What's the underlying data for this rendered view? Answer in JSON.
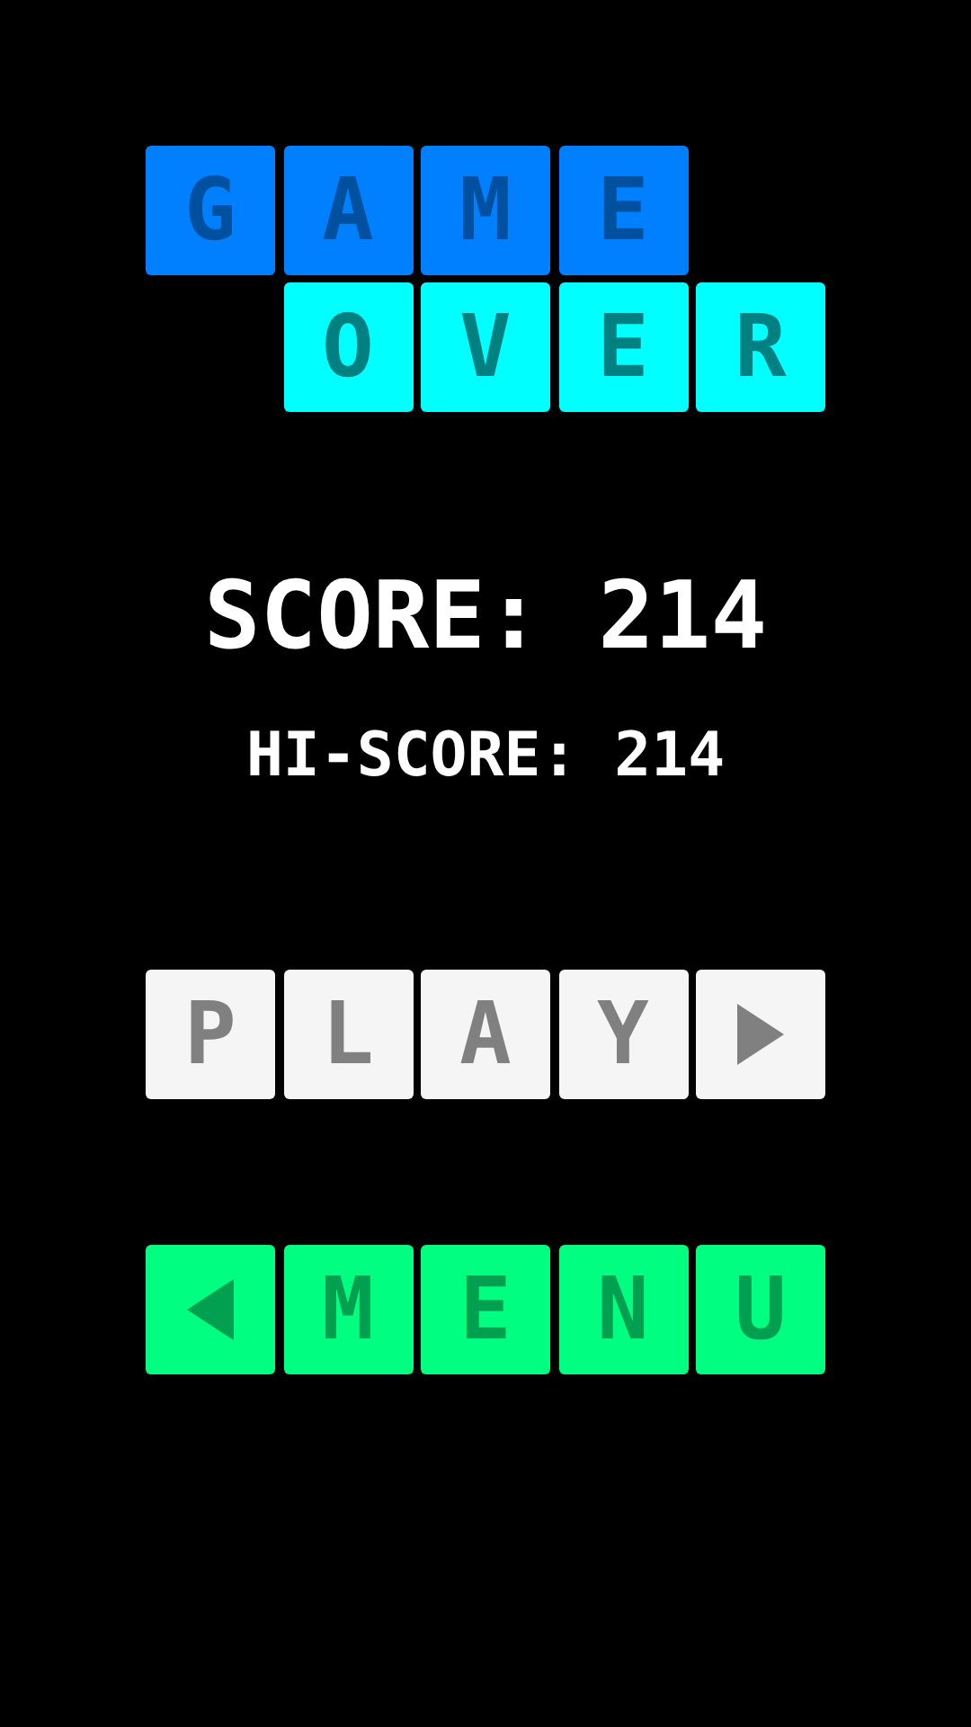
{
  "title": {
    "rows": [
      {
        "kind": "blue",
        "tiles": [
          "G",
          "A",
          "M",
          "E"
        ]
      },
      {
        "kind": "cyan",
        "tiles": [
          "O",
          "V",
          "E",
          "R"
        ]
      }
    ]
  },
  "score": "SCORE: 214",
  "hi_score": "HI-SCORE: 214",
  "buttons": [
    {
      "kind": "play",
      "letters": [
        "P",
        "L",
        "A",
        "Y"
      ]
    },
    {
      "kind": "menu",
      "letters": [
        "M",
        "E",
        "N",
        "U"
      ]
    }
  ]
}
